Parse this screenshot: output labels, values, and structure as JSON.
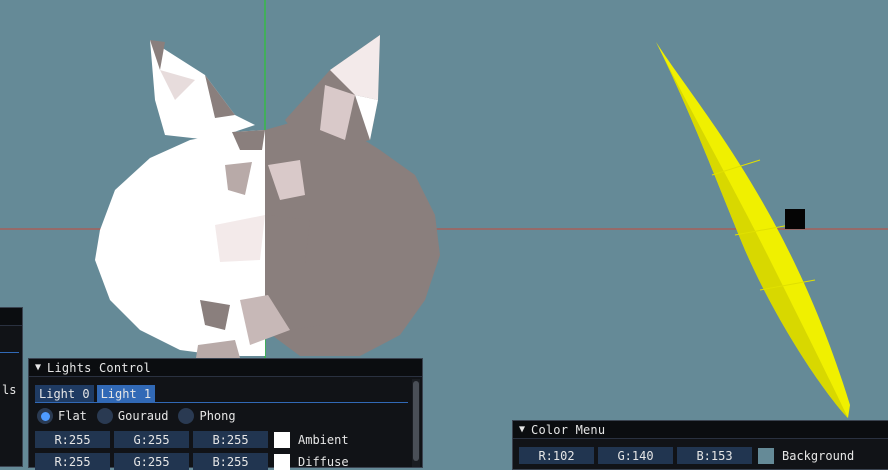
{
  "colors": {
    "background": "#658a97",
    "axis_y": "#1fd31f",
    "axis_x": "#c84b3b",
    "model_light": "#ffffff",
    "model_shadow": "#8a7f7d",
    "banana": "#f0f000",
    "ambient_swatch": "#ffffff",
    "diffuse_swatch": "#ffffff",
    "background_swatch": "#658a97"
  },
  "left_panel": {
    "partial_text": "ls"
  },
  "lights_panel": {
    "title": "Lights Control",
    "tabs": [
      {
        "label": "Light 0",
        "active": false
      },
      {
        "label": "Light 1",
        "active": true
      }
    ],
    "shading": [
      {
        "label": "Flat",
        "selected": true
      },
      {
        "label": "Gouraud",
        "selected": false
      },
      {
        "label": "Phong",
        "selected": false
      }
    ],
    "ambient": {
      "r": "R:255",
      "g": "G:255",
      "b": "B:255",
      "label": "Ambient"
    },
    "diffuse": {
      "r": "R:255",
      "g": "G:255",
      "b": "B:255",
      "label": "Diffuse"
    }
  },
  "color_menu": {
    "title": "Color Menu",
    "background": {
      "r": "R:102",
      "g": "G:140",
      "b": "B:153",
      "label": "Background"
    }
  }
}
